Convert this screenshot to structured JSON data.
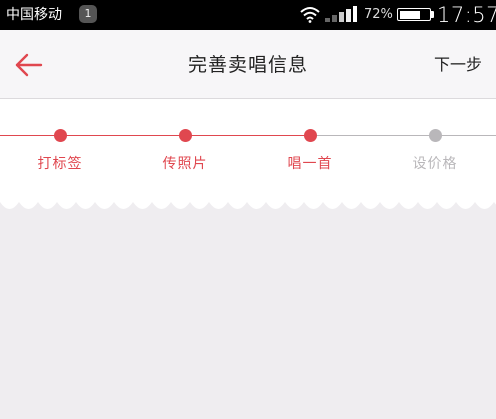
{
  "status_bar": {
    "carrier": "中国移动",
    "notification_count": "1",
    "battery_percent": "72%",
    "battery_level": 0.72,
    "time": "17:57",
    "icons": [
      "wifi-icon",
      "signal-icon",
      "battery-icon"
    ]
  },
  "nav": {
    "back_icon": "arrow-left-icon",
    "title": "完善卖唱信息",
    "next_label": "下一步"
  },
  "steps": {
    "items": [
      {
        "label": "打标签",
        "state": "done"
      },
      {
        "label": "传照片",
        "state": "done"
      },
      {
        "label": "唱一首",
        "state": "current"
      },
      {
        "label": "设价格",
        "state": "todo"
      }
    ]
  },
  "colors": {
    "accent": "#e0474f",
    "inactive": "#b9b7ba",
    "page_background": "#efedf0",
    "nav_background": "#f7f6f8"
  }
}
